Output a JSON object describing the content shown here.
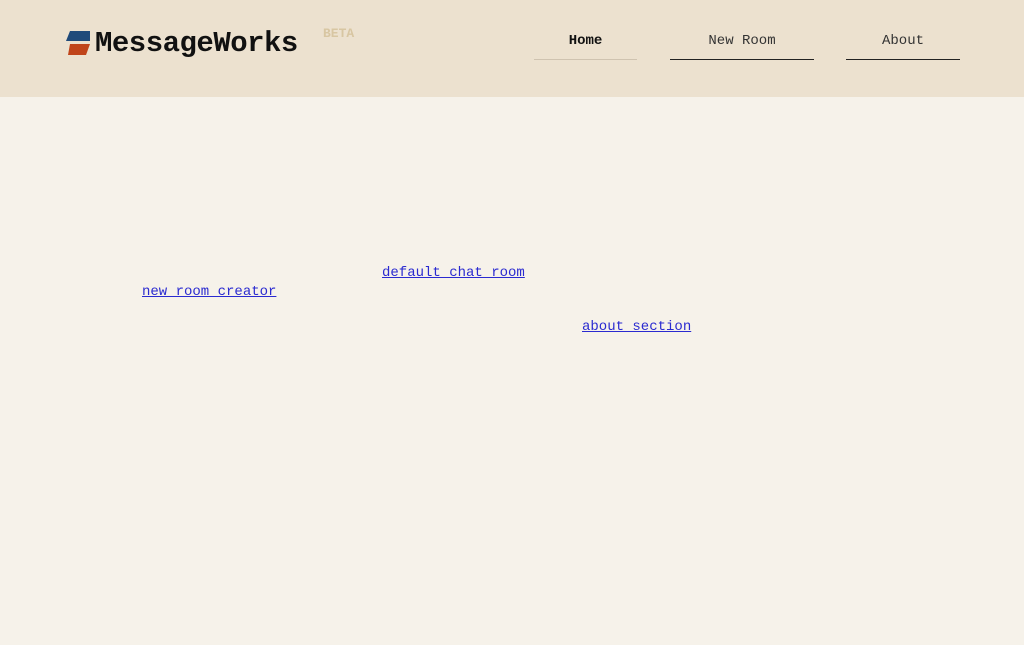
{
  "brand": {
    "name": "MessageWorks",
    "badge": "BETA",
    "colors": {
      "mark_top": "#1f4a7a",
      "mark_bottom": "#c0441a"
    }
  },
  "nav": {
    "home": "Home",
    "new_room": "New Room",
    "about": "About"
  },
  "content": {
    "links": {
      "default_room": "default chat room",
      "new_room_creator": "new room creator",
      "about_section": "about section"
    }
  },
  "theme": {
    "header_bg": "#ece1cf",
    "page_bg": "#f6f2ea",
    "link_color": "#2a2ad0"
  }
}
